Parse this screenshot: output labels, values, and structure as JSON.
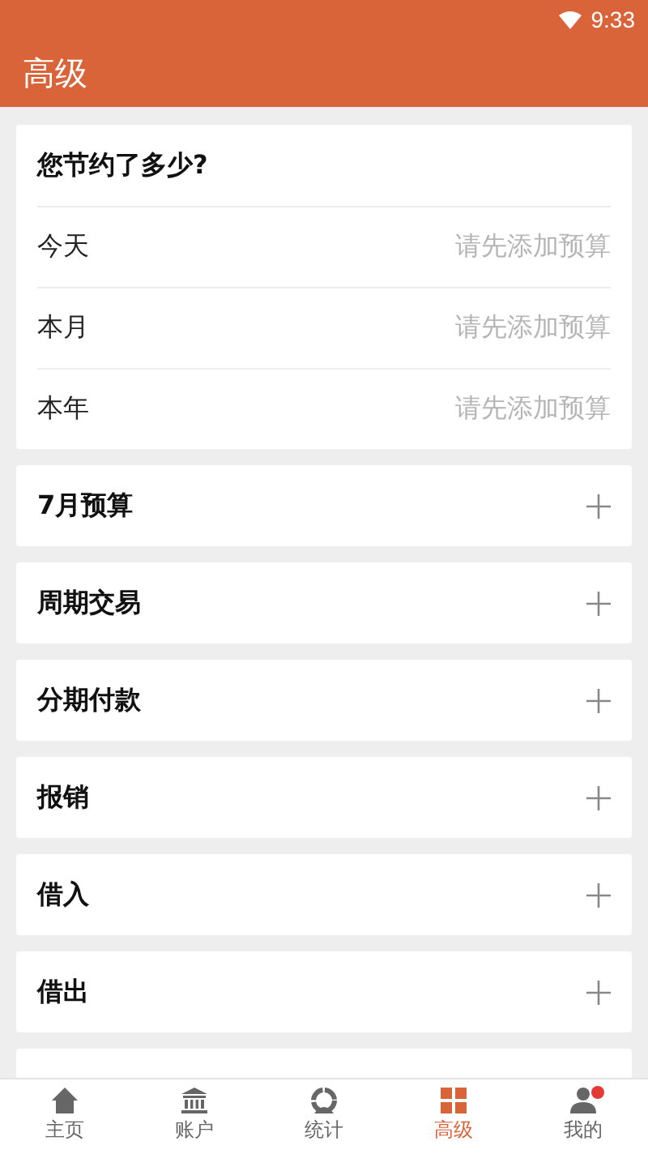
{
  "status_bar": {
    "time": "9:33"
  },
  "app_bar": {
    "title": "高级"
  },
  "savings": {
    "title": "您节约了多少?",
    "rows": [
      {
        "label": "今天",
        "value": "请先添加预算"
      },
      {
        "label": "本月",
        "value": "请先添加预算"
      },
      {
        "label": "本年",
        "value": "请先添加预算"
      }
    ]
  },
  "sections": [
    {
      "kind": "section",
      "title": "7月预算"
    },
    {
      "kind": "section",
      "title": "周期交易"
    },
    {
      "kind": "section",
      "title": "分期付款"
    },
    {
      "kind": "section",
      "title": "报销"
    },
    {
      "kind": "section",
      "title": "借入"
    },
    {
      "kind": "section",
      "title": "借出"
    },
    {
      "kind": "covered"
    }
  ],
  "bottom_nav": [
    {
      "kind": "home",
      "label": "主页",
      "selected": false,
      "badge": false
    },
    {
      "kind": "bank",
      "label": "账户",
      "selected": false,
      "badge": false
    },
    {
      "kind": "stats",
      "label": "统计",
      "selected": false,
      "badge": false
    },
    {
      "kind": "grid",
      "label": "高级",
      "selected": true,
      "badge": false
    },
    {
      "kind": "person",
      "label": "我的",
      "selected": false,
      "badge": true
    }
  ]
}
